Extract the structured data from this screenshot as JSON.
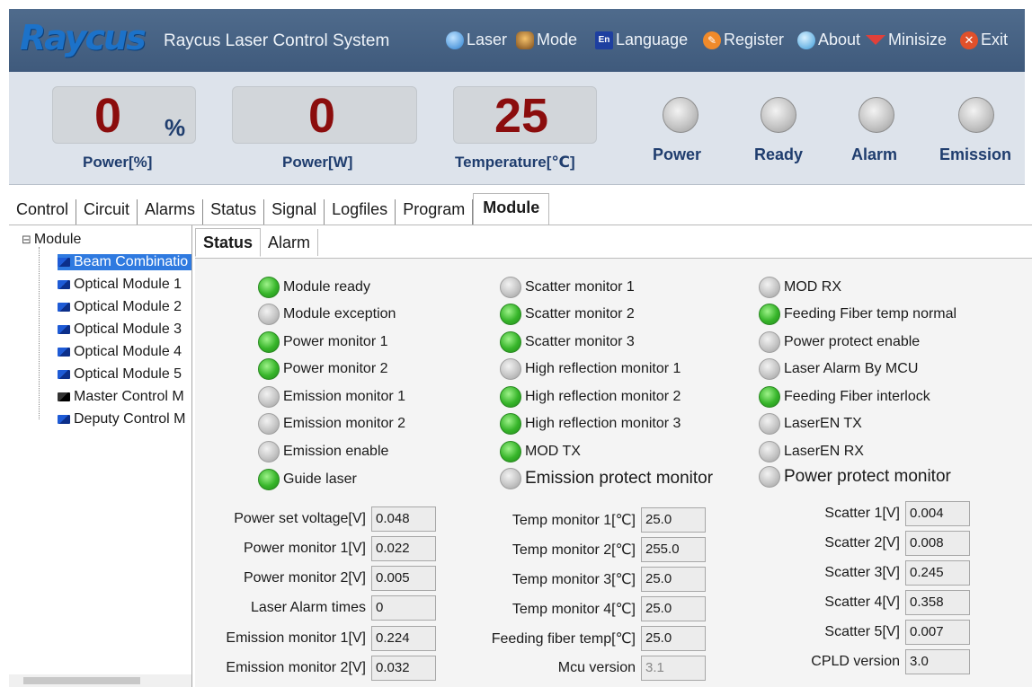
{
  "app": {
    "logo": "Raycus",
    "title": "Raycus Laser Control System"
  },
  "menu": [
    {
      "label": "Laser",
      "icon": "globe-icon"
    },
    {
      "label": "Mode",
      "icon": "people-icon"
    },
    {
      "label": "Language",
      "icon": "language-en-icon",
      "badge": "En"
    },
    {
      "label": "Register",
      "icon": "register-icon"
    },
    {
      "label": "About",
      "icon": "about-icon"
    },
    {
      "label": "Minisize",
      "icon": "minimize-icon"
    },
    {
      "label": "Exit",
      "icon": "exit-icon"
    }
  ],
  "header": {
    "power_pct": {
      "value": "0",
      "unit": "%",
      "label": "Power[%]"
    },
    "power_w": {
      "value": "0",
      "label": "Power[W]"
    },
    "temperature": {
      "value": "25",
      "label": "Temperature[℃]"
    },
    "indicators": [
      {
        "label": "Power",
        "state": "off"
      },
      {
        "label": "Ready",
        "state": "off"
      },
      {
        "label": "Alarm",
        "state": "off"
      },
      {
        "label": "Emission",
        "state": "off"
      }
    ]
  },
  "tabs": [
    "Control",
    "Circuit",
    "Alarms",
    "Status",
    "Signal",
    "Logfiles",
    "Program",
    "Module"
  ],
  "active_tab": "Module",
  "tree": {
    "root": "Module",
    "root_toggle": "⊟",
    "items": [
      "Beam Combinatio",
      "Optical Module 1",
      "Optical Module 2",
      "Optical Module 3",
      "Optical Module 4",
      "Optical Module 5",
      "Master Control M",
      "Deputy Control M"
    ],
    "selected": "Beam Combinatio"
  },
  "subtabs": [
    "Status",
    "Alarm"
  ],
  "active_subtab": "Status",
  "status": {
    "col1": [
      {
        "label": "Module ready",
        "state": "on"
      },
      {
        "label": "Module exception",
        "state": "off"
      },
      {
        "label": "Power monitor 1",
        "state": "on"
      },
      {
        "label": "Power monitor 2",
        "state": "on"
      },
      {
        "label": "Emission monitor 1",
        "state": "off"
      },
      {
        "label": "Emission monitor 2",
        "state": "off"
      },
      {
        "label": "Emission enable",
        "state": "off"
      },
      {
        "label": "Guide laser",
        "state": "on"
      }
    ],
    "col2": [
      {
        "label": "Scatter monitor 1",
        "state": "off"
      },
      {
        "label": "Scatter monitor 2",
        "state": "on"
      },
      {
        "label": "Scatter monitor 3",
        "state": "on"
      },
      {
        "label": "High reflection monitor 1",
        "state": "off"
      },
      {
        "label": "High reflection monitor 2",
        "state": "on"
      },
      {
        "label": "High reflection monitor 3",
        "state": "on"
      },
      {
        "label": "MOD TX",
        "state": "on"
      },
      {
        "label": "Emission protect monitor",
        "state": "off"
      }
    ],
    "col3": [
      {
        "label": "MOD RX",
        "state": "off"
      },
      {
        "label": "Feeding Fiber temp normal",
        "state": "on"
      },
      {
        "label": "Power protect enable",
        "state": "off"
      },
      {
        "label": "Laser Alarm By MCU",
        "state": "off"
      },
      {
        "label": "Feeding Fiber interlock",
        "state": "on"
      },
      {
        "label": "LaserEN TX",
        "state": "off"
      },
      {
        "label": "LaserEN RX",
        "state": "off"
      },
      {
        "label": "Power protect monitor",
        "state": "off"
      }
    ]
  },
  "fields": {
    "col1": [
      {
        "label": "Power set voltage[V]",
        "value": "0.048"
      },
      {
        "label": "Power monitor 1[V]",
        "value": "0.022"
      },
      {
        "label": "Power monitor 2[V]",
        "value": "0.005"
      },
      {
        "label": "Laser Alarm times",
        "value": "0"
      },
      {
        "label": "Emission monitor 1[V]",
        "value": "0.224"
      },
      {
        "label": "Emission monitor 2[V]",
        "value": "0.032"
      }
    ],
    "col2": [
      {
        "label": "Temp monitor 1[℃]",
        "value": "25.0"
      },
      {
        "label": "Temp monitor 2[℃]",
        "value": "255.0"
      },
      {
        "label": "Temp monitor 3[℃]",
        "value": "25.0"
      },
      {
        "label": "Temp monitor 4[℃]",
        "value": "25.0"
      },
      {
        "label": "Feeding fiber temp[℃]",
        "value": "25.0"
      },
      {
        "label": "Mcu version",
        "value": "3.1"
      }
    ],
    "col3": [
      {
        "label": "Scatter 1[V]",
        "value": "0.004"
      },
      {
        "label": "Scatter 2[V]",
        "value": "0.008"
      },
      {
        "label": "Scatter 3[V]",
        "value": "0.245"
      },
      {
        "label": "Scatter 4[V]",
        "value": "0.358"
      },
      {
        "label": "Scatter 5[V]",
        "value": "0.007"
      },
      {
        "label": "CPLD version",
        "value": "3.0"
      }
    ]
  },
  "colors": {
    "accent": "#2f7ae0",
    "led_on": "#37b52a",
    "led_off": "#c6c6c6",
    "readout": "#8b0d0d",
    "label": "#1f3d6e"
  }
}
